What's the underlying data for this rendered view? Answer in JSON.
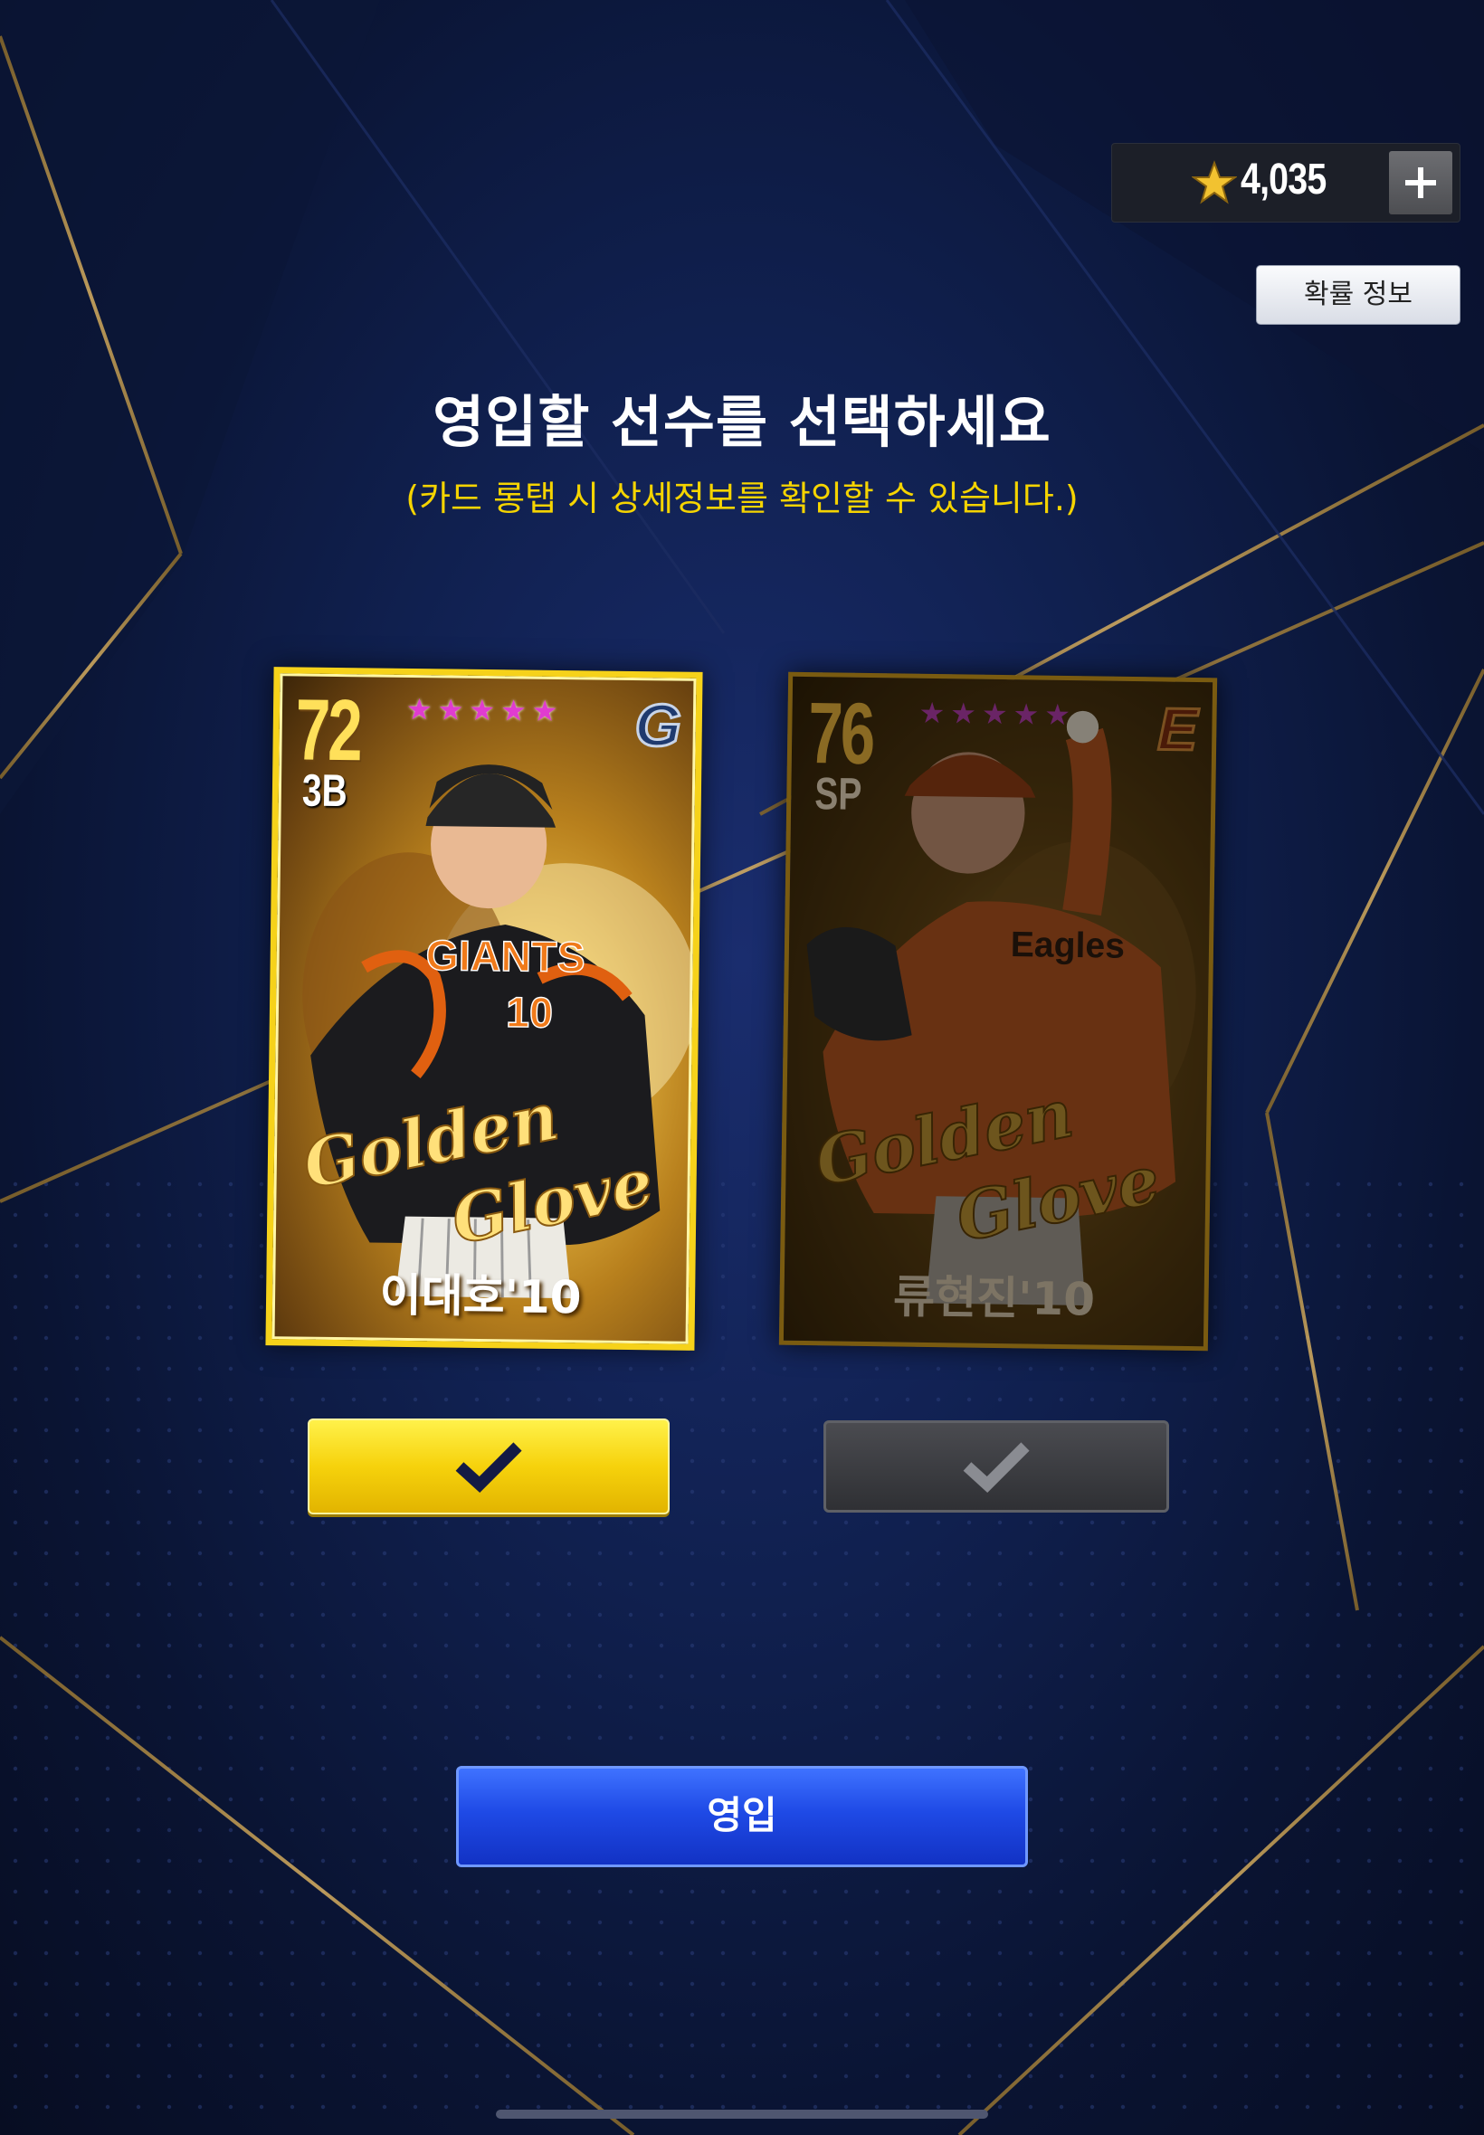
{
  "currency": {
    "icon": "star-icon",
    "amount": "4,035"
  },
  "buttons": {
    "probability_info": "확률 정보",
    "enlist": "영입"
  },
  "header": {
    "title": "영입할 선수를 선택하세요",
    "subtitle": "(카드 롱탭 시 상세정보를 확인할 수 있습니다.)"
  },
  "cards": [
    {
      "overall": "72",
      "position": "3B",
      "stars": 5,
      "team_logo": "giants-logo",
      "name": "이대호'10",
      "selected": true
    },
    {
      "overall": "76",
      "position": "SP",
      "stars": 5,
      "team_logo": "eagles-logo",
      "name": "류현진'10",
      "selected": false
    }
  ],
  "colors": {
    "accent_yellow": "#f6d20c",
    "accent_blue": "#1f4ae6",
    "background": "#10204f"
  }
}
